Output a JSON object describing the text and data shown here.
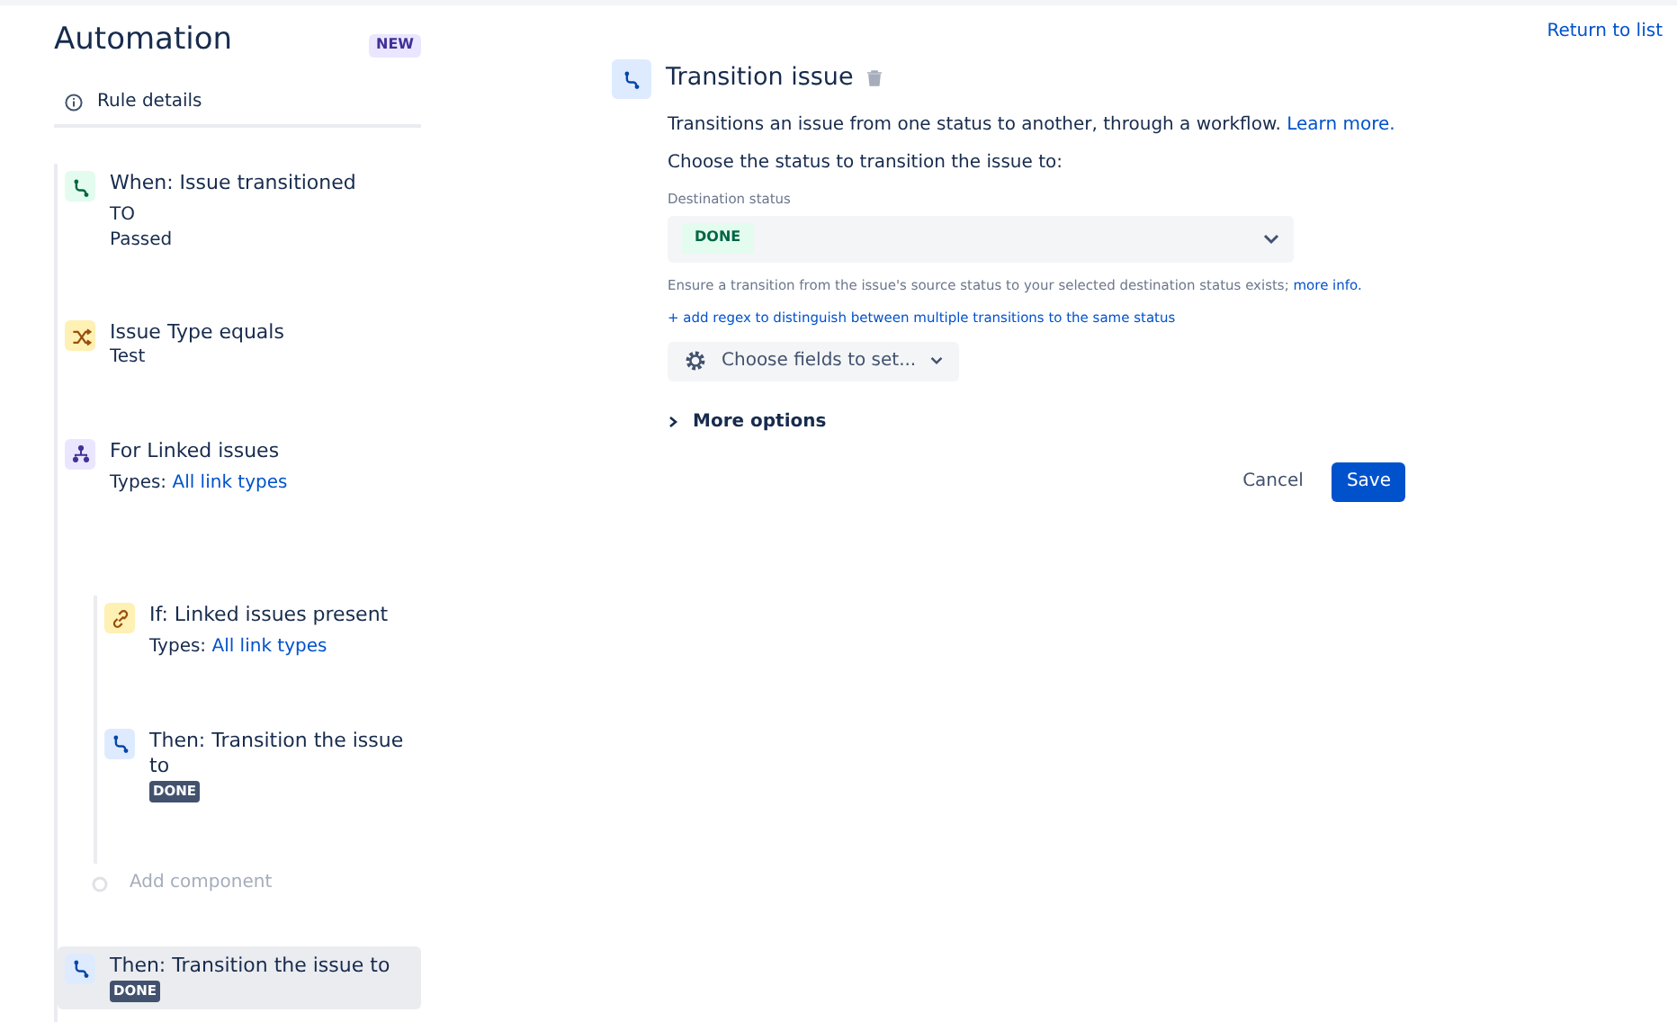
{
  "header": {
    "title": "Automation",
    "badge": "NEW",
    "return_link": "Return to list"
  },
  "rule_details": "Rule details",
  "steps": [
    {
      "kind": "trigger",
      "title": "When: Issue transitioned",
      "lines": [
        {
          "kind": "caps",
          "text": "TO"
        },
        {
          "kind": "text",
          "text": "Passed"
        }
      ],
      "selected": false
    },
    {
      "kind": "condition",
      "title": "Issue Type equals",
      "lines": [
        {
          "kind": "text",
          "text": "Test"
        }
      ],
      "selected": false
    },
    {
      "kind": "branch",
      "title": "For Linked issues",
      "lines": [
        {
          "kind": "types",
          "label": "Types:",
          "value": "All link types"
        }
      ],
      "selected": false,
      "children": [
        {
          "kind": "if",
          "title": "If: Linked issues present",
          "lines": [
            {
              "kind": "types",
              "label": "Types:",
              "value": "All link types"
            }
          ],
          "selected": false
        },
        {
          "kind": "action",
          "title": "Then: Transition the issue to",
          "lines": [
            {
              "kind": "lozenge",
              "text": "DONE"
            }
          ],
          "selected": false
        },
        {
          "kind": "add",
          "title": "Add component",
          "selected": false
        }
      ]
    },
    {
      "kind": "action",
      "title": "Then: Transition the issue to",
      "lines": [
        {
          "kind": "lozenge",
          "text": "DONE"
        }
      ],
      "selected": true
    }
  ],
  "panel": {
    "title": "Transition issue",
    "description": "Transitions an issue from one status to another, through a workflow.",
    "description_link": "Learn more.",
    "prompt": "Choose the status to transition the issue to:",
    "field_label": "Destination status",
    "field_value": "DONE",
    "help": "Ensure a transition from the issue's source status to your selected destination status exists;",
    "help_link": "more info.",
    "regex_link": "+ add regex to distinguish between multiple transitions to the same status",
    "fields_button": "Choose fields to set...",
    "more_options": {
      "label": "More options",
      "expanded": false
    },
    "buttons": [
      {
        "kind": "subtle",
        "label": "Cancel"
      },
      {
        "kind": "primary",
        "label": "Save"
      }
    ]
  }
}
